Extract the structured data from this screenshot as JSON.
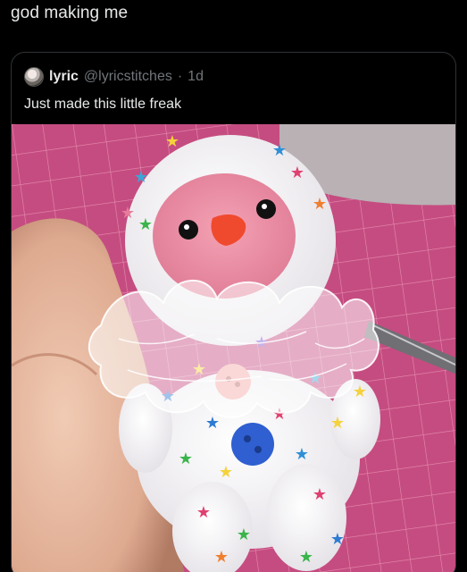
{
  "post": {
    "text": "god making me"
  },
  "quote": {
    "display_name": "lyric",
    "handle": "@lyricstitches",
    "separator": "·",
    "time": "1d",
    "text": "Just made this little freak",
    "avatar_icon": "user-avatar",
    "media_icon": "photo-plush-toy"
  },
  "colors": {
    "background": "#000000",
    "border": "#2f3336",
    "primary_text": "#e7e9ea",
    "secondary_text": "#71767b",
    "mat_pink": "#c24a7c"
  }
}
